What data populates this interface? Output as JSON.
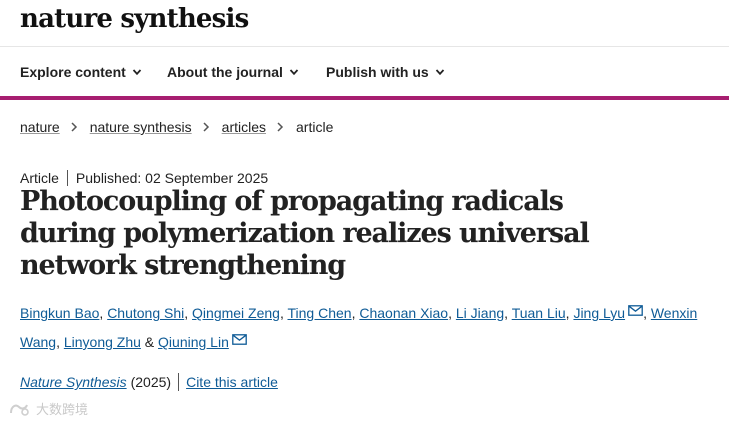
{
  "header": {
    "logo": "nature synthesis"
  },
  "nav": {
    "items": [
      {
        "label": "Explore content"
      },
      {
        "label": "About the journal"
      },
      {
        "label": "Publish with us"
      }
    ]
  },
  "breadcrumb": {
    "items": [
      "nature",
      "nature synthesis",
      "articles"
    ],
    "current": "article"
  },
  "meta": {
    "type": "Article",
    "published": "Published: 02 September 2025"
  },
  "title": "Photocoupling of propagating radicals during polymerization realizes universal network strengthening",
  "authors": [
    "Bingkun Bao",
    "Chutong Shi",
    "Qingmei Zeng",
    "Ting Chen",
    "Chaonan Xiao",
    "Li Jiang",
    "Tuan Liu",
    "Jing Lyu",
    "Wenxin Wang",
    "Linyong Zhu",
    "Qiuning Lin"
  ],
  "author_separator": ",",
  "author_conjunction": "&",
  "citation": {
    "journal": "Nature Synthesis",
    "year": "(2025)",
    "cite_label": "Cite this article"
  },
  "watermark": {
    "text": "大数跨境"
  },
  "colors": {
    "accent": "#a71e70",
    "link": "#0f5b96",
    "text": "#222222"
  }
}
